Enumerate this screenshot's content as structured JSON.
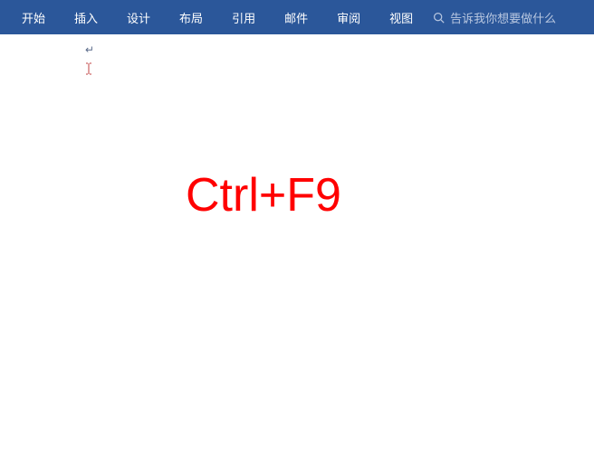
{
  "ribbon": {
    "tabs": [
      {
        "label": "开始"
      },
      {
        "label": "插入"
      },
      {
        "label": "设计"
      },
      {
        "label": "布局"
      },
      {
        "label": "引用"
      },
      {
        "label": "邮件"
      },
      {
        "label": "审阅"
      },
      {
        "label": "视图"
      }
    ],
    "tell_me_placeholder": "告诉我你想要做什么"
  },
  "document": {
    "paragraph_mark": "↵",
    "annotation_text": "Ctrl+F9"
  }
}
